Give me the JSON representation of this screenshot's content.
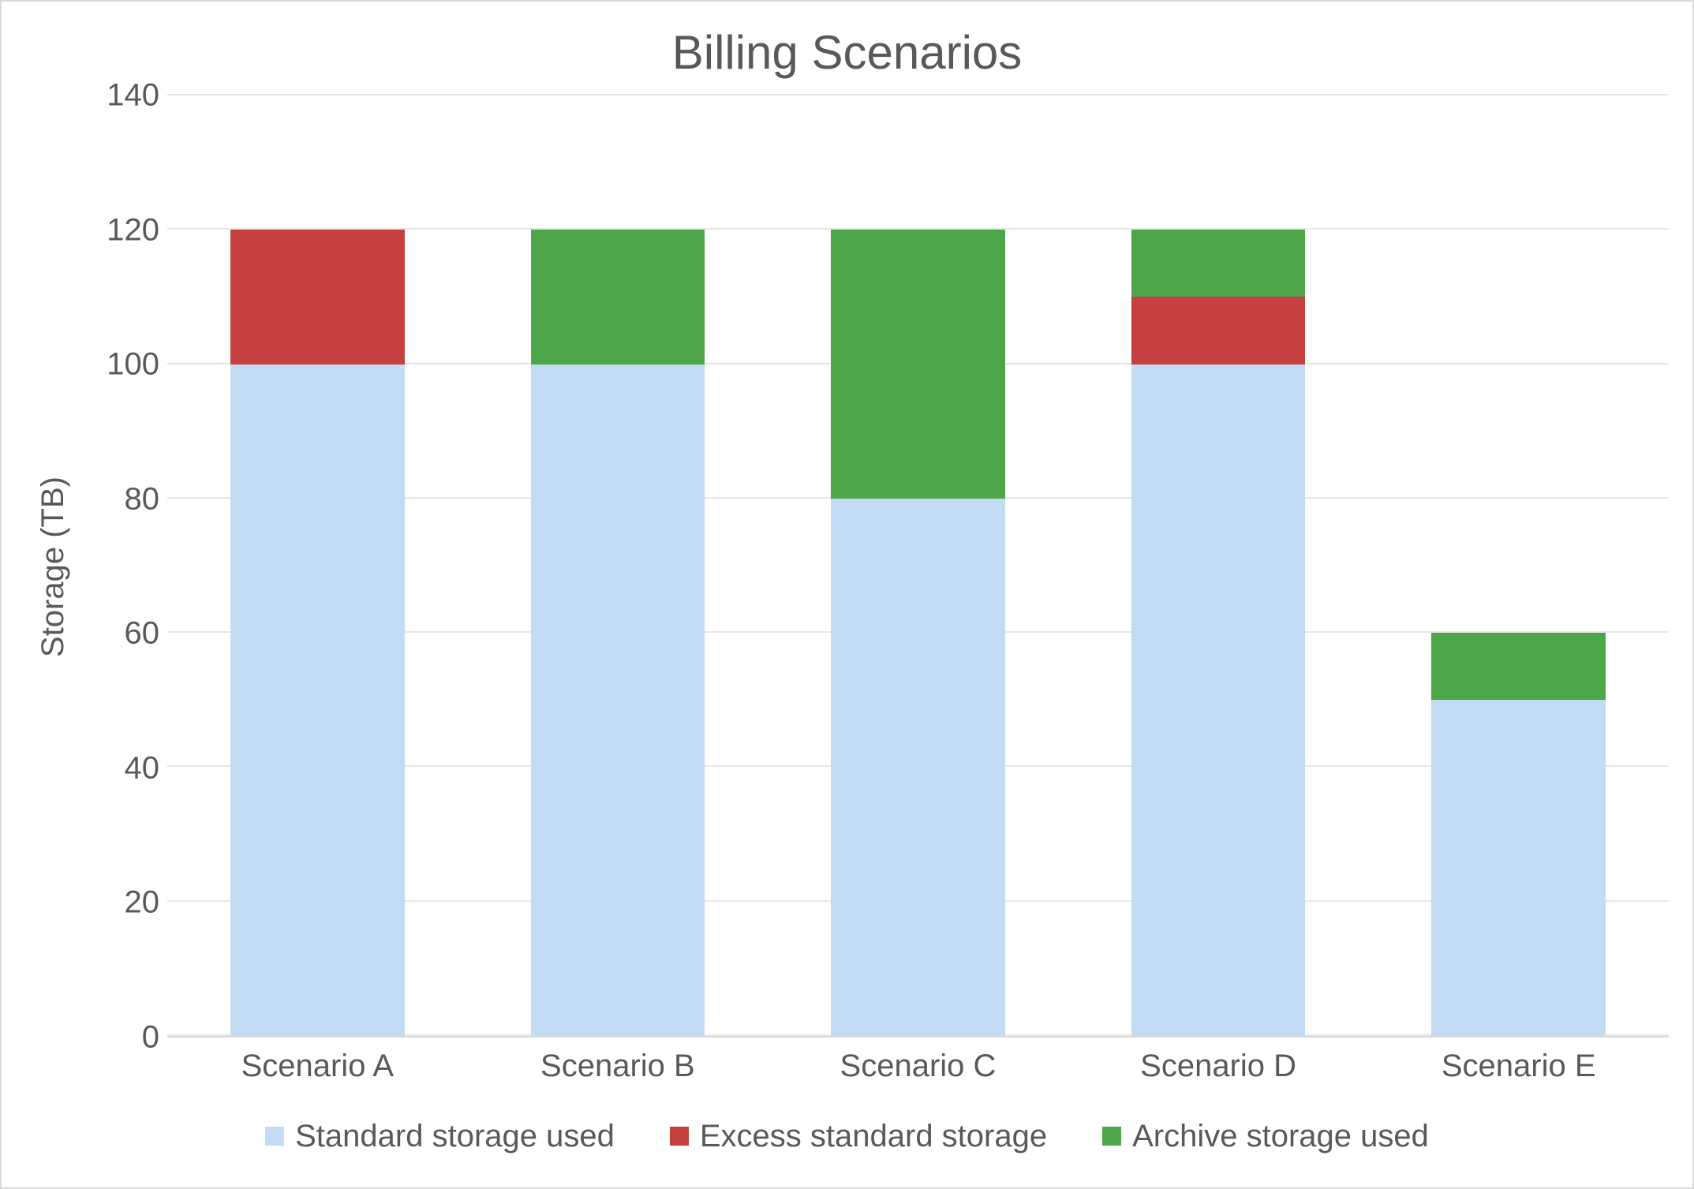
{
  "chart_data": {
    "type": "bar",
    "title": "Billing Scenarios",
    "ylabel": "Storage (TB)",
    "xlabel": "",
    "ylim": [
      0,
      140
    ],
    "ytick_step": 20,
    "categories": [
      "Scenario A",
      "Scenario B",
      "Scenario C",
      "Scenario D",
      "Scenario E"
    ],
    "series": [
      {
        "name": "Standard storage used",
        "color": "#c3dbf3",
        "values": [
          100,
          100,
          80,
          100,
          50
        ]
      },
      {
        "name": "Excess standard storage",
        "color": "#c6403f",
        "values": [
          20,
          0,
          0,
          10,
          0
        ]
      },
      {
        "name": "Archive storage used",
        "color": "#4da647",
        "values": [
          0,
          20,
          40,
          10,
          10
        ]
      }
    ],
    "legend_position": "bottom",
    "grid": true
  }
}
